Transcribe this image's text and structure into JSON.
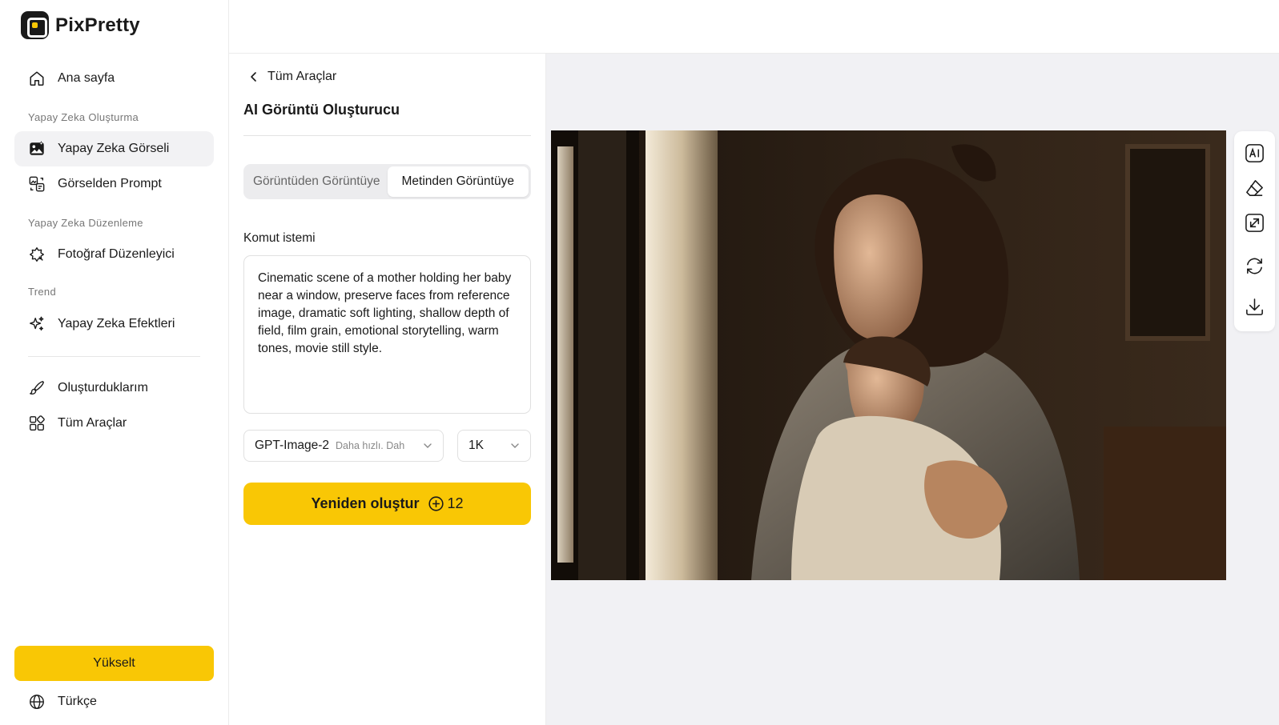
{
  "app": {
    "name": "PixPretty"
  },
  "sidebar": {
    "home_label": "Ana sayfa",
    "section_create": "Yapay Zeka Oluşturma",
    "ai_image_label": "Yapay Zeka Görseli",
    "image_to_prompt_label": "Görselden Prompt",
    "section_edit": "Yapay Zeka Düzenleme",
    "photo_editor_label": "Fotoğraf Düzenleyici",
    "section_trend": "Trend",
    "ai_effects_label": "Yapay Zeka Efektleri",
    "my_creations_label": "Oluşturduklarım",
    "all_tools_label": "Tüm Araçlar",
    "upgrade_label": "Yükselt",
    "language_label": "Türkçe"
  },
  "panel": {
    "back_label": "Tüm Araçlar",
    "title": "AI Görüntü Oluşturucu",
    "tabs": [
      {
        "label": "Görüntüden Görüntüye",
        "active": false
      },
      {
        "label": "Metinden Görüntüye",
        "active": true
      }
    ],
    "prompt_label": "Komut istemi",
    "prompt_value": "Cinematic scene of a mother holding her baby near a window, preserve faces from reference image, dramatic soft lighting, shallow depth of field, film grain, emotional storytelling, warm tones, movie still style.",
    "model_select": {
      "value": "GPT-Image-2",
      "hint": "Daha hızlı. Dah"
    },
    "resolution_select": {
      "value": "1K"
    },
    "generate_label": "Yeniden oluştur",
    "generate_cost": "12"
  },
  "canvas": {
    "tools": [
      "ai-edit-icon",
      "eraser-icon",
      "upscale-icon",
      "regenerate-icon",
      "download-icon"
    ]
  },
  "colors": {
    "accent": "#f9c705",
    "canvas_bg": "#f1f1f4",
    "active_nav": "#f2f2f4"
  }
}
